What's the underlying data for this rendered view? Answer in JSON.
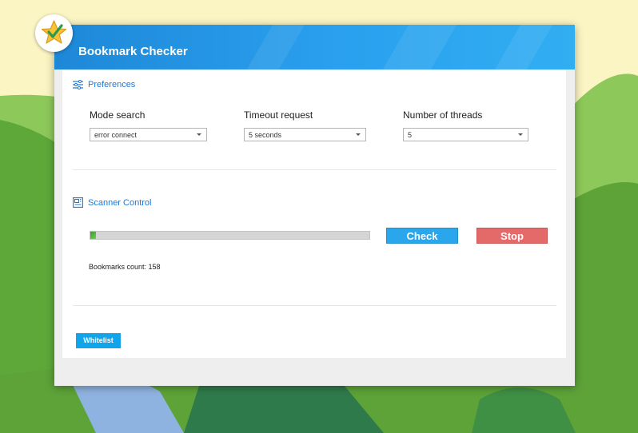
{
  "app": {
    "title": "Bookmark Checker",
    "icon": "star-check-icon"
  },
  "preferences": {
    "title": "Preferences",
    "icon": "sliders-icon",
    "mode_search": {
      "label": "Mode search",
      "value": "error connect"
    },
    "timeout_request": {
      "label": "Timeout request",
      "value": "5 seconds"
    },
    "number_of_threads": {
      "label": "Number of threads",
      "value": "5"
    }
  },
  "scanner": {
    "title": "Scanner Control",
    "icon": "scanner-icon",
    "progress": 0.02,
    "check_label": "Check",
    "stop_label": "Stop",
    "bookmarks_count": "Bookmarks count: 158"
  },
  "footer": {
    "whitelist_label": "Whitelist"
  },
  "colors": {
    "header": "#2196f3",
    "accent": "#1c78d9",
    "check": "#29a6ec",
    "stop": "#e46a69",
    "whitelist": "#12a4ea"
  }
}
